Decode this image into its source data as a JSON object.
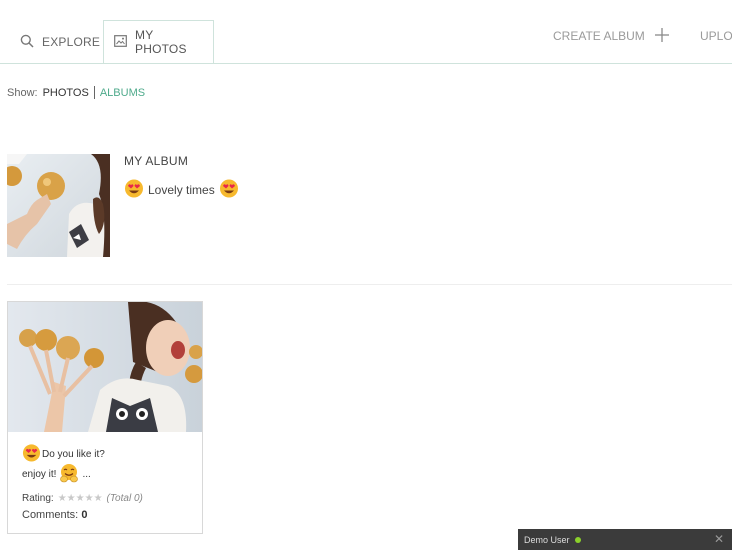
{
  "tabs": {
    "explore": "EXPLORE",
    "my_photos": "MY PHOTOS",
    "create_album": "CREATE ALBUM",
    "upload": "UPLOAD"
  },
  "filter": {
    "label": "Show:",
    "photos": "PHOTOS",
    "albums": "ALBUMS",
    "active": "ALBUMS"
  },
  "album": {
    "title": "MY ALBUM",
    "description": "Lovely times"
  },
  "photo": {
    "caption_line1": "Do you like it?",
    "caption_line2": "enjoy it!",
    "caption_suffix": "...",
    "rating_label": "Rating:",
    "rating_value": 0,
    "rating_total": "(Total 0)",
    "comments_label": "Comments:",
    "comments_count": "0"
  },
  "chat": {
    "user": "Demo User",
    "status": "online"
  },
  "colors": {
    "accent": "#4eaa8b",
    "tab_border": "#cfe3dc",
    "chat_bg": "#3b3b3b",
    "online": "#8bd12b"
  }
}
